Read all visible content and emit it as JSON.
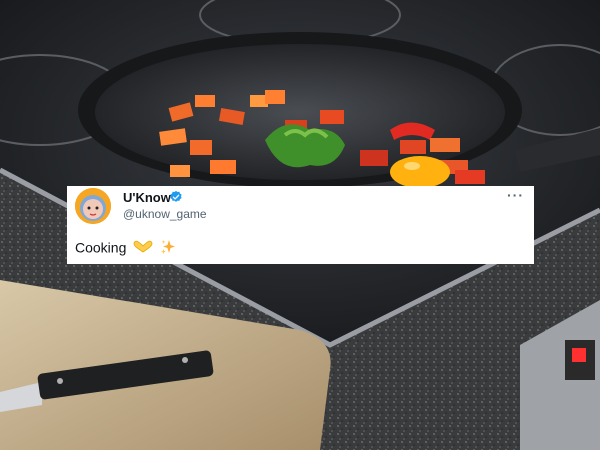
{
  "tweet": {
    "display_name": "U'Know",
    "handle": "@uknow_game",
    "text": "Cooking",
    "emojis": [
      "heart-hands-emoji",
      "sparkles-emoji"
    ],
    "more_label": "···",
    "verified": true,
    "verified_color": "#1d9bf0"
  },
  "scene": {
    "subject": "photo-of-vegetables-frying-in-pan-on-stovetop"
  }
}
